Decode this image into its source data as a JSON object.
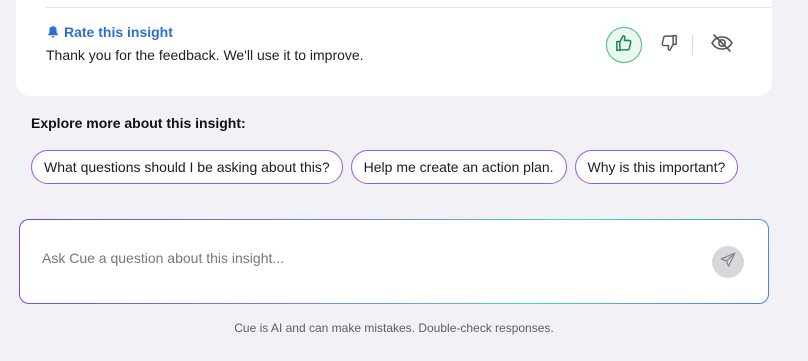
{
  "rate_section": {
    "title": "Rate this insight",
    "feedback_message": "Thank you for the feedback. We'll use it to improve.",
    "icons": [
      "bell-icon",
      "thumbs-up-icon",
      "thumbs-down-icon",
      "eye-off-icon"
    ],
    "thumbs_up_selected": true
  },
  "explore": {
    "heading": "Explore more about this insight:",
    "chips": [
      {
        "label": "What questions should I be asking about this?"
      },
      {
        "label": "Help me create an action plan."
      },
      {
        "label": "Why is this important?"
      }
    ]
  },
  "ask": {
    "placeholder": "Ask Cue a question about this insight...",
    "value": "",
    "send_icon": "send-icon"
  },
  "disclaimer": "Cue is AI and can make mistakes. Double-check responses.",
  "colors": {
    "accent_blue": "#2d6fce",
    "positive_green": "#3fbf83",
    "chip_border": "#9d58dc",
    "background": "#f1f1f6"
  }
}
